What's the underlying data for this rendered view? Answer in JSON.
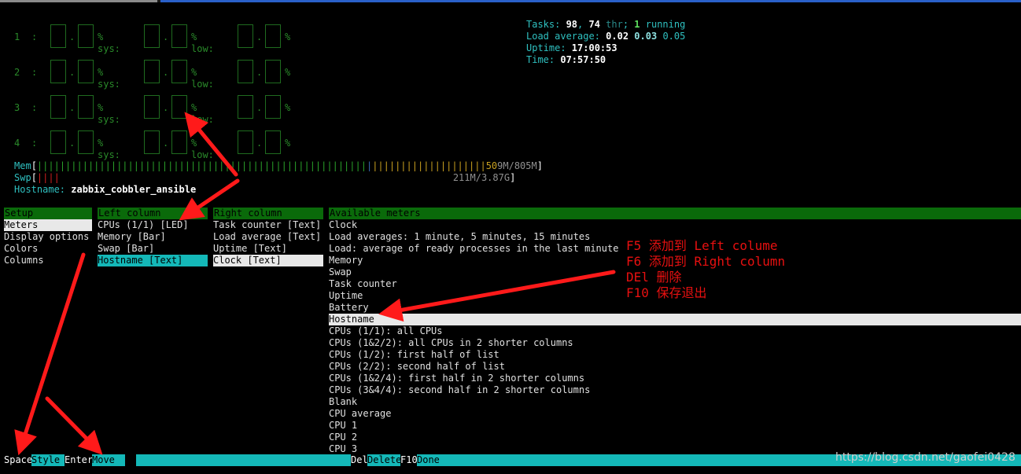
{
  "cpu_meters": [
    {
      "num": "1",
      "sep": ":"
    },
    {
      "num": "2",
      "sep": ":"
    },
    {
      "num": "3",
      "sep": ":"
    },
    {
      "num": "4",
      "sep": ":"
    }
  ],
  "cpu_labels": {
    "sys": "% sys:",
    "low": "% low:",
    "pct": "%",
    "dot": "."
  },
  "info": {
    "tasks_label": "Tasks: ",
    "tasks": "98",
    "comma": ", ",
    "threads": "74",
    "thr": " thr",
    "semi": "; ",
    "running": "1",
    "running_label": " running",
    "load_label": "Load average: ",
    "load1": "0.02",
    "load5": "0.03",
    "load15": "0.05",
    "uptime_label": "Uptime: ",
    "uptime": "17:00:53",
    "time_label": "Time: ",
    "time": "07:57:50"
  },
  "mem": {
    "label": "Mem",
    "value_prefix": "50",
    "value": "9M/805M"
  },
  "swp": {
    "label": "Swp",
    "value": "211M/3.87G"
  },
  "hostname": {
    "label": "Hostname: ",
    "value": "zabbix_cobbler_ansible"
  },
  "setup": {
    "header": "Setup",
    "items": [
      "Meters",
      "Display options",
      "Colors",
      "Columns"
    ]
  },
  "left_column": {
    "header": "Left column",
    "items": [
      "CPUs (1/1) [LED]",
      "Memory [Bar]",
      "Swap [Bar]",
      "Hostname [Text]"
    ]
  },
  "right_column": {
    "header": "Right column",
    "items": [
      "Task counter [Text]",
      "Load average [Text]",
      "Uptime [Text]",
      "Clock [Text]"
    ]
  },
  "available": {
    "header": "Available meters",
    "items": [
      "Clock",
      "Load averages: 1 minute, 5 minutes, 15 minutes",
      "Load: average of ready processes in the last minute",
      "Memory",
      "Swap",
      "Task counter",
      "Uptime",
      "Battery",
      "Hostname",
      "CPUs (1/1): all CPUs",
      "CPUs (1&2/2): all CPUs in 2 shorter columns",
      "CPUs (1/2): first half of list",
      "CPUs (2/2): second half of list",
      "CPUs (1&2/4): first half in 2 shorter columns",
      "CPUs (3&4/4): second half in 2 shorter columns",
      "Blank",
      "CPU average",
      "CPU 1",
      "CPU 2",
      "CPU 3"
    ]
  },
  "function_bar": {
    "space_key": "Space",
    "space_label": "Style",
    "enter_key": "Enter",
    "enter_label": "Move",
    "del_key": "Del",
    "del_label": "Delete",
    "f10_key": "F10",
    "f10_label": "Done"
  },
  "annotations": [
    "F5 添加到 Left colume",
    "F6 添加到 Right column",
    "DEl 删除",
    "F10 保存退出"
  ],
  "watermark": "https://blog.csdn.net/gaofei0428",
  "colors": {
    "arrow": "#ff1a1a",
    "cyan": "#14b8b8",
    "header_green": "#0a6a0a"
  }
}
